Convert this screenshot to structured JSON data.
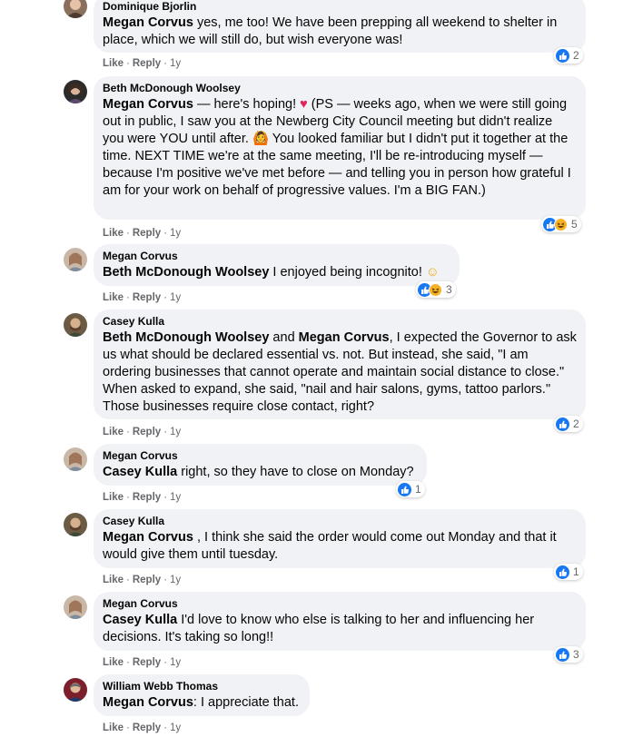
{
  "comments": [
    {
      "author": "Dominique Bjorlin",
      "tag": "Megan Corvus",
      "text": " yes, me too! We have been prepping all weekend to shelter in place, which we will still do, but wish everyone was!",
      "like": "Like",
      "reply": "Reply",
      "time": "1y",
      "reactions": {
        "count": "2",
        "types": [
          "like"
        ]
      }
    },
    {
      "author": "Beth McDonough Woolsey",
      "tag": "Megan Corvus",
      "text_a": " — here's hoping! ",
      "heart": "♥",
      "text_b": " (PS — weeks ago, when we were still going out in public, I saw you at the Newberg City Council meeting but didn't realize you were YOU until after. ",
      "emoji": "🙆",
      "text_c": " You looked familiar but I didn't put it together at the time. NEXT TIME we're at the same meeting, I'll be re-introducing myself — because I'm positive we've met before — and telling you in person how grateful I am for your work on behalf of progressive values. I'm a BIG FAN.)",
      "like": "Like",
      "reply": "Reply",
      "time": "1y",
      "reactions": {
        "count": "5",
        "types": [
          "like",
          "haha"
        ]
      }
    },
    {
      "author": "Megan Corvus",
      "tag": "Beth McDonough Woolsey",
      "text": " I enjoyed being incognito! ",
      "emoji": "☺",
      "like": "Like",
      "reply": "Reply",
      "time": "1y",
      "reactions": {
        "count": "3",
        "types": [
          "like",
          "haha"
        ]
      }
    },
    {
      "author": "Casey Kulla",
      "tag": "Beth McDonough Woolsey",
      "and": " and ",
      "tag2": "Megan Corvus",
      "text": ", I expected the Governor to ask us what should be declared essential vs. not. But instead, she said, \"I am ordering businesses that cannot operate and maintain social distance to close.\" When asked to expand, she said, \"nail and hair salons, gyms, tattoo parlors.\" Those businesses require close contact, right?",
      "like": "Like",
      "reply": "Reply",
      "time": "1y",
      "reactions": {
        "count": "2",
        "types": [
          "like"
        ]
      }
    },
    {
      "author": "Megan Corvus",
      "tag": "Casey Kulla",
      "text": " right, so they have to close on Monday?",
      "like": "Like",
      "reply": "Reply",
      "time": "1y",
      "reactions": {
        "count": "1",
        "types": [
          "like"
        ]
      }
    },
    {
      "author": "Casey Kulla",
      "tag": "Megan Corvus",
      "text": " , I think she said the order would come out Monday and that it would give them until tuesday.",
      "like": "Like",
      "reply": "Reply",
      "time": "1y",
      "reactions": {
        "count": "1",
        "types": [
          "like"
        ]
      }
    },
    {
      "author": "Megan Corvus",
      "tag": "Casey Kulla",
      "text": " I'd love to know who else is talking to her and influencing her decisions. It's taking so long!!",
      "like": "Like",
      "reply": "Reply",
      "time": "1y",
      "reactions": {
        "count": "3",
        "types": [
          "like"
        ]
      }
    },
    {
      "author": "William Webb Thomas",
      "tag": "Megan Corvus",
      "text": ": I appreciate that.",
      "like": "Like",
      "reply": "Reply",
      "time": "1y"
    }
  ],
  "colors": {
    "bubble": "#f0f2f5",
    "like_blue": "#1877f2",
    "haha_yellow": "#f7b125",
    "heart_red": "#e0245e",
    "meta_gray": "#65676b"
  },
  "icons": [
    "like-icon",
    "haha-icon",
    "heart-emoji",
    "person-gesturing-emoji",
    "smile-emoji",
    "avatar"
  ]
}
